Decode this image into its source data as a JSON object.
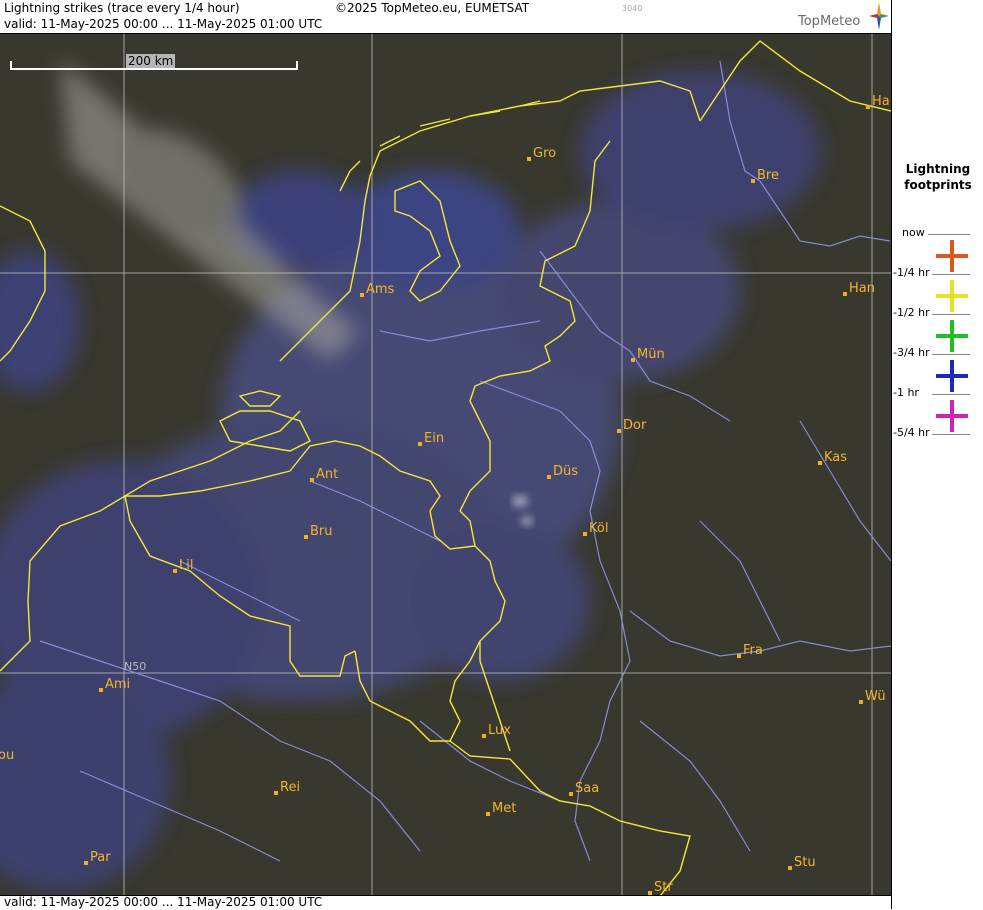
{
  "header": {
    "title": "Lightning strikes (trace every 1/4 hour)",
    "copyright": "©2025 TopMeteo.eu, EUMETSAT",
    "code": "3040",
    "valid": "valid:  11-May-2025 00:00 ... 11-May-2025 01:00 UTC",
    "brand": "TopMeteo"
  },
  "footer": {
    "valid": "valid:  11-May-2025 00:00 ... 11-May-2025 01:00 UTC"
  },
  "scale": {
    "label": "200 km"
  },
  "grid": {
    "lat_label": "N50"
  },
  "legend": {
    "title_line1": "Lightning",
    "title_line2": "footprints",
    "items": [
      {
        "label": "now",
        "color": "#d85a1a"
      },
      {
        "label": "-1/4 hr",
        "color": "#e8e020"
      },
      {
        "label": "-1/2 hr",
        "color": "#20c020"
      },
      {
        "label": "-3/4 hr",
        "color": "#1a2ab8"
      },
      {
        "label": "-1 hr",
        "color": "#d020c0"
      },
      {
        "label": "-5/4 hr",
        "color": ""
      }
    ]
  },
  "cities": [
    {
      "name": "Gro"
    },
    {
      "name": "Bre"
    },
    {
      "name": "Ha"
    },
    {
      "name": "Ams"
    },
    {
      "name": "Han"
    },
    {
      "name": "Mün"
    },
    {
      "name": "Dor"
    },
    {
      "name": "Ein"
    },
    {
      "name": "Kas"
    },
    {
      "name": "Ant"
    },
    {
      "name": "Düs"
    },
    {
      "name": "Bru"
    },
    {
      "name": "Köl"
    },
    {
      "name": "Lil"
    },
    {
      "name": "Fra"
    },
    {
      "name": "Ami"
    },
    {
      "name": "Wü"
    },
    {
      "name": "Lux"
    },
    {
      "name": "ou"
    },
    {
      "name": "Rei"
    },
    {
      "name": "Saa"
    },
    {
      "name": "Met"
    },
    {
      "name": "Stu"
    },
    {
      "name": "Par"
    },
    {
      "name": "Str"
    }
  ]
}
